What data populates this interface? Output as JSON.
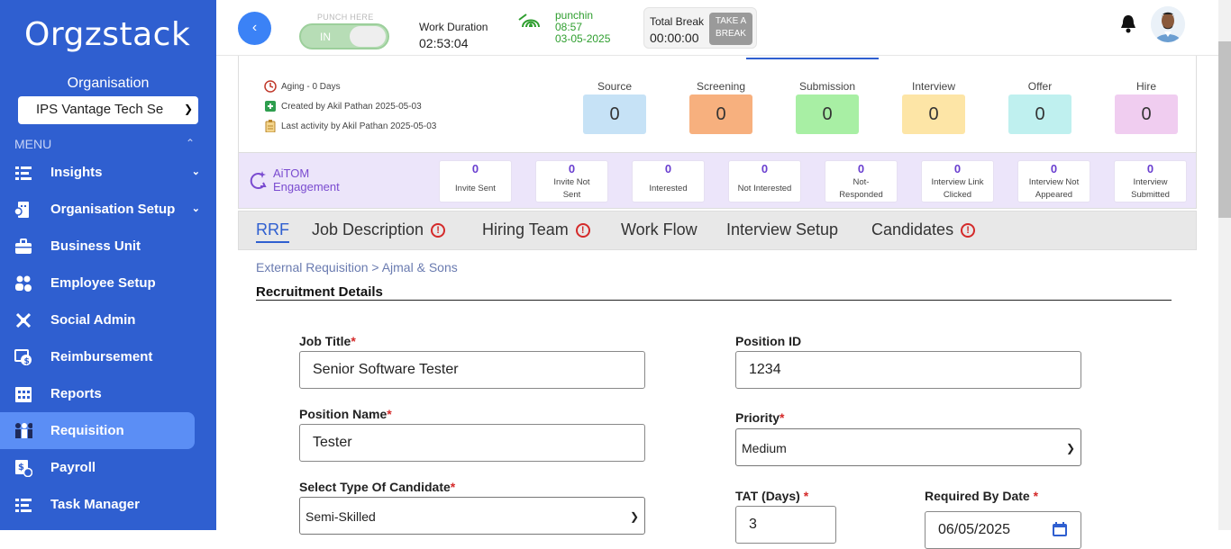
{
  "sidebar": {
    "logo": "Orgzstack",
    "org_label": "Organisation",
    "org_select": "IPS Vantage Tech Se",
    "menu_head": "MENU",
    "items": [
      {
        "label": "Insights",
        "icon": "insights-icon",
        "has_chev": true
      },
      {
        "label": "Organisation Setup",
        "icon": "organisation-icon",
        "has_chev": true
      },
      {
        "label": "Business Unit",
        "icon": "briefcase-icon",
        "has_chev": false
      },
      {
        "label": "Employee Setup",
        "icon": "people-icon",
        "has_chev": false
      },
      {
        "label": "Social Admin",
        "icon": "social-icon",
        "has_chev": false
      },
      {
        "label": "Reimbursement",
        "icon": "reimbursement-icon",
        "has_chev": false
      },
      {
        "label": "Reports",
        "icon": "reports-icon",
        "has_chev": false
      },
      {
        "label": "Requisition",
        "icon": "requisition-icon",
        "has_chev": false,
        "active": true
      },
      {
        "label": "Payroll",
        "icon": "payroll-icon",
        "has_chev": false
      },
      {
        "label": "Task Manager",
        "icon": "task-icon",
        "has_chev": false
      }
    ]
  },
  "topbar": {
    "punch_here": "PUNCH HERE",
    "punch_state": "IN",
    "work_duration_label": "Work Duration",
    "work_duration": "02:53:04",
    "punchin_label": "punchin",
    "punchin_time": "08:57",
    "punchin_date": "03-05-2025",
    "total_break_label": "Total Break",
    "total_break": "00:00:00",
    "take_break_line1": "TAKE A",
    "take_break_line2": "BREAK"
  },
  "summary": {
    "aging": "Aging - 0 Days",
    "created_by": "Created by Akil Pathan 2025-05-03",
    "last_activity": "Last activity by Akil Pathan 2025-05-03",
    "stages": [
      {
        "label": "Source",
        "value": "0",
        "color": "#c6e2f6"
      },
      {
        "label": "Screening",
        "value": "0",
        "color": "#f7b07e"
      },
      {
        "label": "Submission",
        "value": "0",
        "color": "#a8efa4"
      },
      {
        "label": "Interview",
        "value": "0",
        "color": "#fde5a6"
      },
      {
        "label": "Offer",
        "value": "0",
        "color": "#bff0ef"
      },
      {
        "label": "Hire",
        "value": "0",
        "color": "#f0cdf0"
      }
    ]
  },
  "aitom": {
    "line1": "AiTOM",
    "line2": "Engagement",
    "metrics": [
      {
        "value": "0",
        "l1": "Invite Sent",
        "l2": ""
      },
      {
        "value": "0",
        "l1": "Invite Not",
        "l2": "Sent"
      },
      {
        "value": "0",
        "l1": "Interested",
        "l2": ""
      },
      {
        "value": "0",
        "l1": "Not Interested",
        "l2": ""
      },
      {
        "value": "0",
        "l1": "Not-",
        "l2": "Responded"
      },
      {
        "value": "0",
        "l1": "Interview Link",
        "l2": "Clicked"
      },
      {
        "value": "0",
        "l1": "Interview Not",
        "l2": "Appeared"
      },
      {
        "value": "0",
        "l1": "Interview",
        "l2": "Submitted"
      }
    ]
  },
  "tabs": [
    {
      "label": "RRF",
      "warn": false,
      "active": true
    },
    {
      "label": "Job Description",
      "warn": true
    },
    {
      "label": "Hiring Team",
      "warn": true
    },
    {
      "label": "Work Flow",
      "warn": false
    },
    {
      "label": "Interview Setup",
      "warn": false
    },
    {
      "label": "Candidates",
      "warn": true
    }
  ],
  "breadcrumb": "External Requisition > Ajmal & Sons",
  "section_title": "Recruitment Details",
  "form": {
    "job_title_label": "Job Title",
    "job_title": "Senior Software Tester",
    "position_id_label": "Position ID",
    "position_id": "1234",
    "position_name_label": "Position Name",
    "position_name": "Tester",
    "priority_label": "Priority",
    "priority": "Medium",
    "candidate_type_label": "Select Type Of Candidate",
    "candidate_type": "Semi-Skilled",
    "tat_label": "TAT (Days)",
    "tat": "3",
    "required_by_label": "Required By Date",
    "required_by": "06/05/2025",
    "required_marker": "*"
  }
}
